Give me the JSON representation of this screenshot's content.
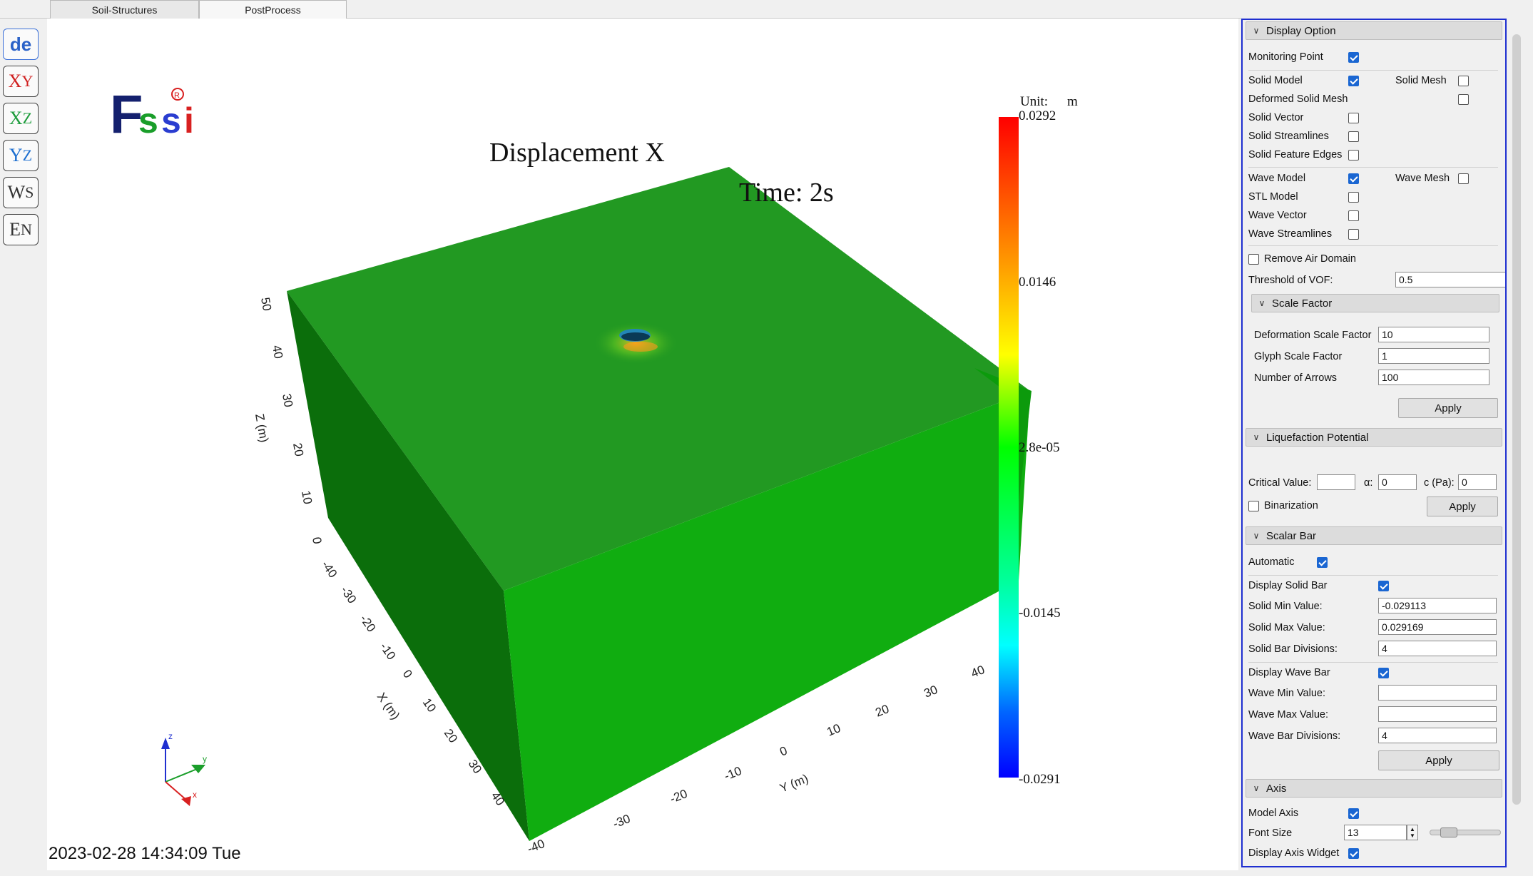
{
  "tabs": [
    {
      "label": "Soil-Structures"
    },
    {
      "label": "PostProcess"
    }
  ],
  "toolbar": {
    "items": [
      {
        "name": "mode-button",
        "text": "de"
      },
      {
        "name": "view-xy-button",
        "main": "X",
        "sub": "Y"
      },
      {
        "name": "view-xz-button",
        "main": "X",
        "sub": "Z"
      },
      {
        "name": "view-yz-button",
        "main": "Y",
        "sub": "Z"
      },
      {
        "name": "view-ws-button",
        "main": "W",
        "sub": "S"
      },
      {
        "name": "view-en-button",
        "main": "E",
        "sub": "N"
      }
    ]
  },
  "viewport": {
    "logo": "Fssi",
    "registered": "®",
    "title": "Displacement X",
    "time": "Time: 2s",
    "timestamp": "2023-02-28 14:34:09 Tue",
    "unit_label": "Unit:",
    "unit": "m",
    "colorbar": {
      "ticks": [
        "0.0292",
        "0.0146",
        "2.8e-05",
        "-0.0145",
        "-0.0291"
      ],
      "min": -0.0291,
      "max": 0.0292,
      "colors": [
        "#ff0000",
        "#ff8000",
        "#ffff00",
        "#00ff00",
        "#00ffff",
        "#0000ff"
      ]
    },
    "axes": {
      "z_label": "Z (m)",
      "z_ticks": [
        "0",
        "10",
        "20",
        "30",
        "40",
        "50"
      ],
      "x_label": "X (m)",
      "x_ticks": [
        "-40",
        "-30",
        "-20",
        "-10",
        "0",
        "10",
        "20",
        "30",
        "40"
      ],
      "y_label": "Y (m)",
      "y_ticks": [
        "-40",
        "-30",
        "-20",
        "-10",
        "0",
        "10",
        "20",
        "30",
        "40"
      ]
    },
    "orientation_widget": {
      "x": "x",
      "y": "y",
      "z": "z"
    },
    "colors": {
      "top": "#229922",
      "left": "#0b6e0b",
      "front": "#0fae0f"
    }
  },
  "panel": {
    "display_option": {
      "header": "Display Option",
      "monitoring_point": {
        "label": "Monitoring Point",
        "checked": true
      },
      "solid_model": {
        "label": "Solid Model",
        "checked": true
      },
      "solid_mesh": {
        "label": "Solid Mesh",
        "checked": false
      },
      "deformed_solid_mesh": {
        "label": "Deformed Solid Mesh",
        "checked": false
      },
      "solid_vector": {
        "label": "Solid Vector",
        "checked": false
      },
      "solid_streamlines": {
        "label": "Solid Streamlines",
        "checked": false
      },
      "solid_feature_edges": {
        "label": "Solid Feature Edges",
        "checked": false
      },
      "wave_model": {
        "label": "Wave Model",
        "checked": true
      },
      "wave_mesh": {
        "label": "Wave Mesh",
        "checked": false
      },
      "stl_model": {
        "label": "STL Model",
        "checked": false
      },
      "wave_vector": {
        "label": "Wave Vector",
        "checked": false
      },
      "wave_streamlines": {
        "label": "Wave Streamlines",
        "checked": false
      },
      "remove_air_domain": {
        "label": "Remove Air Domain",
        "checked": false
      },
      "threshold_vof": {
        "label": "Threshold of VOF:",
        "value": "0.5"
      }
    },
    "scale_factor": {
      "header": "Scale Factor",
      "deformation": {
        "label": "Deformation Scale Factor",
        "value": "10"
      },
      "glyph": {
        "label": "Glyph Scale Factor",
        "value": "1"
      },
      "arrows": {
        "label": "Number of Arrows",
        "value": "100"
      },
      "apply": "Apply"
    },
    "liquefaction": {
      "header": "Liquefaction Potential",
      "critical": {
        "label": "Critical Value:",
        "value": ""
      },
      "alpha": {
        "label": "α:",
        "value": "0"
      },
      "c": {
        "label": "c (Pa):",
        "value": "0"
      },
      "binarization": {
        "label": "Binarization",
        "checked": false
      },
      "apply": "Apply"
    },
    "scalar_bar": {
      "header": "Scalar Bar",
      "automatic": {
        "label": "Automatic",
        "checked": true
      },
      "display_solid_bar": {
        "label": "Display Solid Bar",
        "checked": true
      },
      "solid_min": {
        "label": "Solid Min Value:",
        "value": "-0.029113"
      },
      "solid_max": {
        "label": "Solid Max Value:",
        "value": "0.029169"
      },
      "solid_div": {
        "label": "Solid Bar Divisions:",
        "value": "4"
      },
      "display_wave_bar": {
        "label": "Display Wave Bar",
        "checked": true
      },
      "wave_min": {
        "label": "Wave Min Value:",
        "value": ""
      },
      "wave_max": {
        "label": "Wave Max Value:",
        "value": ""
      },
      "wave_div": {
        "label": "Wave Bar Divisions:",
        "value": "4"
      },
      "apply": "Apply"
    },
    "axis": {
      "header": "Axis",
      "model_axis": {
        "label": "Model Axis",
        "checked": true
      },
      "font_size": {
        "label": "Font Size",
        "value": "13",
        "slider": 0.2
      },
      "axis_widget": {
        "label": "Display Axis Widget",
        "checked": true
      }
    }
  }
}
